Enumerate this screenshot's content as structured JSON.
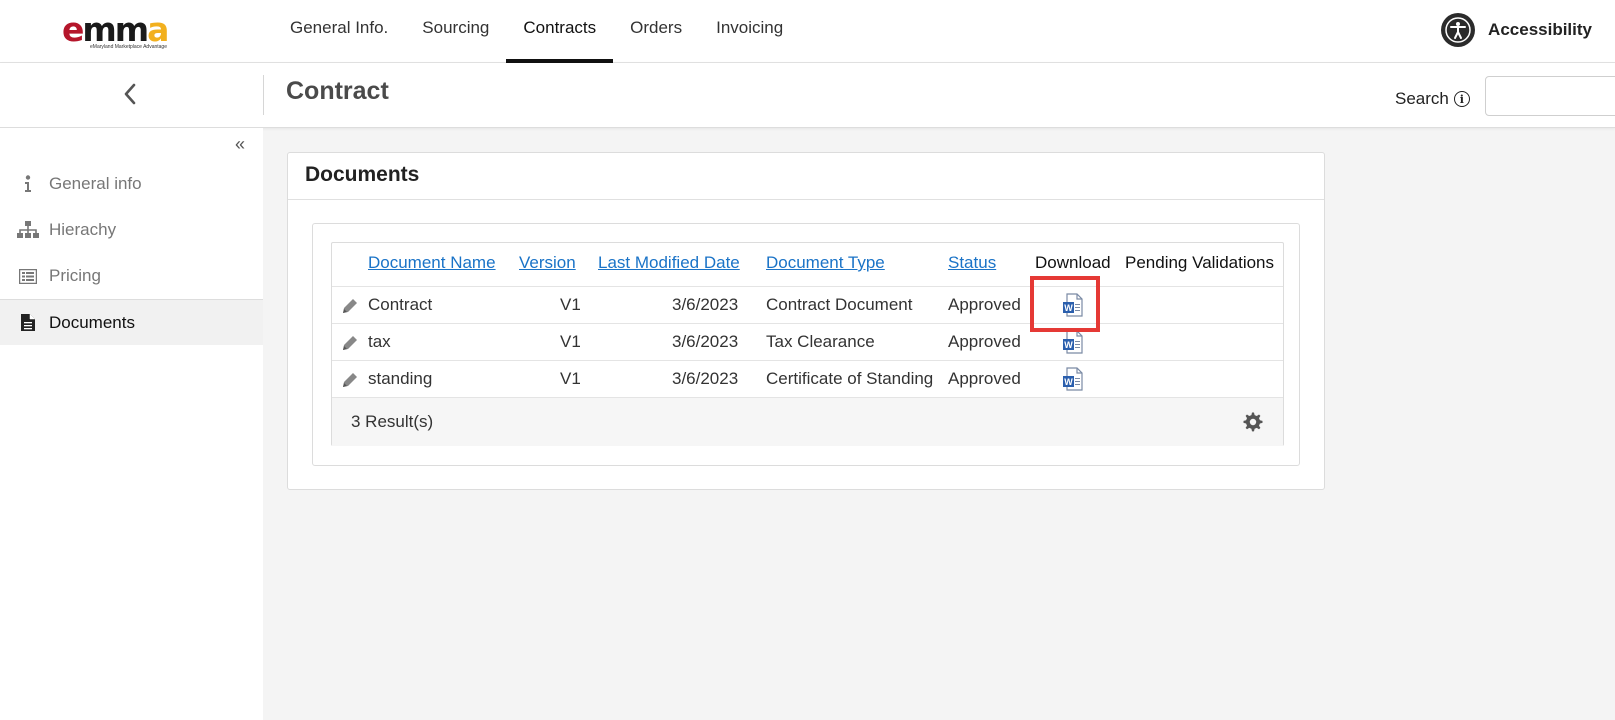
{
  "brand": {
    "logo_text": "emma",
    "tagline": "eMaryland Marketplace Advantage",
    "colors": {
      "e": "#b5162b",
      "mm": "#1a1a1a",
      "a": "#f2b01e"
    }
  },
  "nav": {
    "tabs": [
      {
        "label": "General Info."
      },
      {
        "label": "Sourcing"
      },
      {
        "label": "Contracts",
        "active": true
      },
      {
        "label": "Orders"
      },
      {
        "label": "Invoicing"
      }
    ]
  },
  "accessibility": {
    "label": "Accessibility",
    "icon": "accessibility-icon"
  },
  "subheader": {
    "title": "Contract",
    "search_label": "Search",
    "search_value": ""
  },
  "sidebar": {
    "items": [
      {
        "label": "General info",
        "icon": "info-icon"
      },
      {
        "label": "Hierachy",
        "icon": "hierarchy-icon"
      },
      {
        "label": "Pricing",
        "icon": "list-icon"
      },
      {
        "label": "Documents",
        "icon": "document-icon",
        "active": true
      }
    ]
  },
  "documents": {
    "title": "Documents",
    "columns": [
      "Document Name",
      "Version",
      "Last Modified Date",
      "Document Type",
      "Status",
      "Download",
      "Pending Validations"
    ],
    "rows": [
      {
        "name": "Contract",
        "version": "V1",
        "modified": "3/6/2023",
        "type": "Contract Document",
        "status": "Approved",
        "pending": ""
      },
      {
        "name": "tax",
        "version": "V1",
        "modified": "3/6/2023",
        "type": "Tax Clearance",
        "status": "Approved",
        "pending": ""
      },
      {
        "name": "standing",
        "version": "V1",
        "modified": "3/6/2023",
        "type": "Certificate of Standing",
        "status": "Approved",
        "pending": ""
      }
    ],
    "results_text": "3 Result(s)",
    "download_icon": "word-document-icon",
    "highlight_color": "#e53935",
    "link_color": "#1a73c7"
  }
}
